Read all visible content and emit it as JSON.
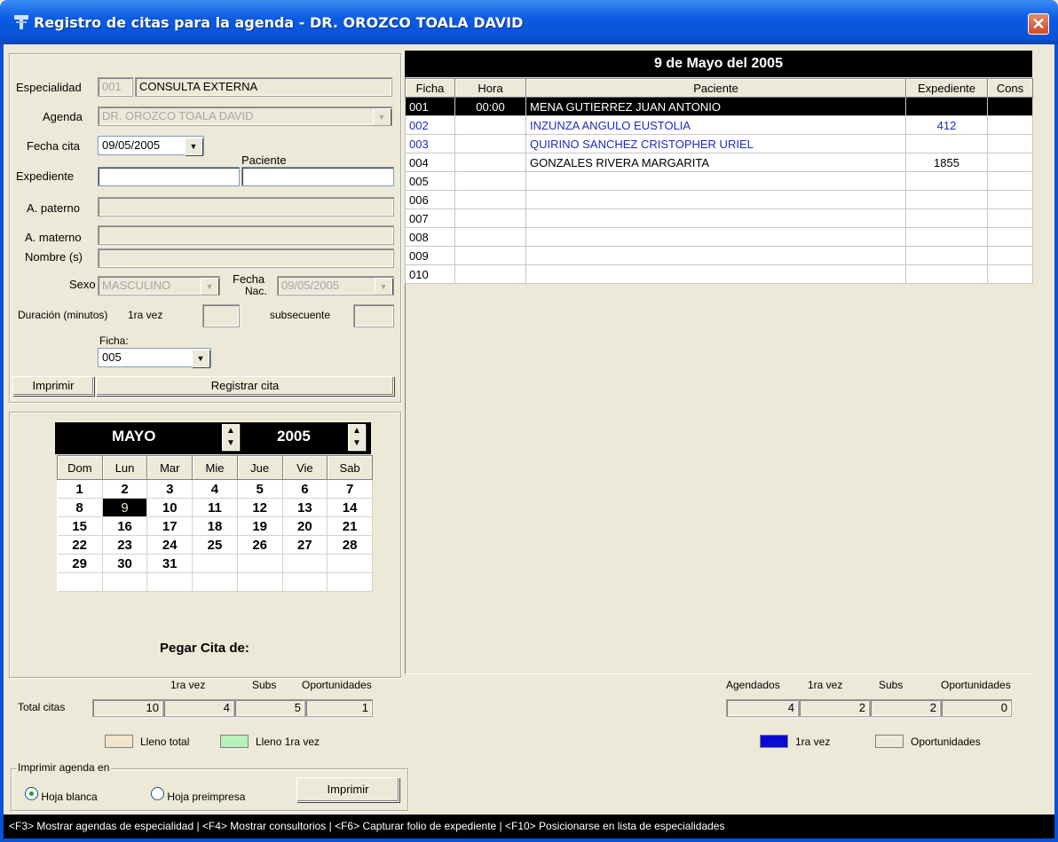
{
  "window": {
    "title": "Registro de citas para la agenda - DR. OROZCO TOALA DAVID",
    "close_glyph": "✕"
  },
  "form": {
    "especialidad_label": "Especialidad",
    "especialidad_code": "001",
    "especialidad_name": "CONSULTA EXTERNA",
    "agenda_label": "Agenda",
    "agenda_value": "DR. OROZCO TOALA DAVID",
    "fecha_cita_label": "Fecha cita",
    "fecha_cita_value": "09/05/2005",
    "paciente_label": "Paciente",
    "expediente_label": "Expediente",
    "expediente_value": "",
    "paciente_value": "",
    "a_paterno_label": "A. paterno",
    "a_materno_label": "A. materno",
    "nombre_label": "Nombre (s)",
    "sexo_label": "Sexo",
    "sexo_value": "MASCULINO",
    "fecha_nac_label_1": "Fecha",
    "fecha_nac_label_2": "Nac.",
    "fecha_nac_value": "09/05/2005",
    "duracion_label": "Duración (minutos)",
    "primera_vez_label": "1ra vez",
    "subsecuente_label": "subsecuente",
    "ficha_label": "Ficha:",
    "ficha_value": "005",
    "imprimir_label": "Imprimir",
    "registrar_label": "Registrar cita"
  },
  "calendar": {
    "month": "MAYO",
    "year": "2005",
    "weekdays": [
      "Dom",
      "Lun",
      "Mar",
      "Mie",
      "Jue",
      "Vie",
      "Sab"
    ],
    "weeks": [
      [
        "1",
        "2",
        "3",
        "4",
        "5",
        "6",
        "7"
      ],
      [
        "8",
        "9",
        "10",
        "11",
        "12",
        "13",
        "14"
      ],
      [
        "15",
        "16",
        "17",
        "18",
        "19",
        "20",
        "21"
      ],
      [
        "22",
        "23",
        "24",
        "25",
        "26",
        "27",
        "28"
      ],
      [
        "29",
        "30",
        "31",
        "",
        "",
        "",
        ""
      ],
      [
        "",
        "",
        "",
        "",
        "",
        "",
        ""
      ]
    ],
    "selected_day": "9",
    "pegar_label": "Pegar Cita de:"
  },
  "schedule": {
    "date_header": "9 de Mayo del 2005",
    "columns": [
      "Ficha",
      "Hora",
      "Paciente",
      "Expediente",
      "Cons"
    ],
    "rows": [
      {
        "ficha": "001",
        "hora": "00:00",
        "paciente": "MENA GUTIERREZ JUAN ANTONIO",
        "expediente": "",
        "cons": "",
        "style": "selected"
      },
      {
        "ficha": "002",
        "hora": "",
        "paciente": "INZUNZA ANGULO EUSTOLIA",
        "expediente": "412",
        "cons": "",
        "style": "blue"
      },
      {
        "ficha": "003",
        "hora": "",
        "paciente": "QUIRINO SANCHEZ CRISTOPHER URIEL",
        "expediente": "",
        "cons": "",
        "style": "blue"
      },
      {
        "ficha": "004",
        "hora": "",
        "paciente": "GONZALES RIVERA MARGARITA",
        "expediente": "1855",
        "cons": "",
        "style": "normal"
      },
      {
        "ficha": "005",
        "hora": "",
        "paciente": "",
        "expediente": "",
        "cons": "",
        "style": "normal"
      },
      {
        "ficha": "006",
        "hora": "",
        "paciente": "",
        "expediente": "",
        "cons": "",
        "style": "normal"
      },
      {
        "ficha": "007",
        "hora": "",
        "paciente": "",
        "expediente": "",
        "cons": "",
        "style": "normal"
      },
      {
        "ficha": "008",
        "hora": "",
        "paciente": "",
        "expediente": "",
        "cons": "",
        "style": "normal"
      },
      {
        "ficha": "009",
        "hora": "",
        "paciente": "",
        "expediente": "",
        "cons": "",
        "style": "normal"
      },
      {
        "ficha": "010",
        "hora": "",
        "paciente": "",
        "expediente": "",
        "cons": "",
        "style": "normal"
      }
    ]
  },
  "totals_left": {
    "row_label": "Total citas",
    "h_primera": "1ra vez",
    "h_subs": "Subs",
    "h_oport": "Oportunidades",
    "total": "10",
    "primera": "4",
    "subs": "5",
    "oport": "1"
  },
  "totals_right": {
    "h_agendados": "Agendados",
    "h_primera": "1ra vez",
    "h_subs": "Subs",
    "h_oport": "Oportunidades",
    "agendados": "4",
    "primera": "2",
    "subs": "2",
    "oport": "0"
  },
  "legend_left": {
    "lleno_total": "Lleno total",
    "lleno_total_color": "#f2e4c9",
    "lleno_primera": "Lleno 1ra vez",
    "lleno_primera_color": "#b9f0b9"
  },
  "legend_right": {
    "primera": "1ra vez",
    "primera_color": "#0a0ad0",
    "oport": "Oportunidades",
    "oport_color": "#ece9d8"
  },
  "print_group": {
    "title": "Imprimir agenda en",
    "opt_blanca": "Hoja blanca",
    "opt_preimpresa": "Hoja preimpresa",
    "selected": "Hoja blanca",
    "button": "Imprimir"
  },
  "status_bar": "<F3> Mostrar agendas de especialidad   |   <F4> Mostrar consultorios   |   <F6> Capturar folio de expediente   |   <F10> Posicionarse en lista de especialidades"
}
